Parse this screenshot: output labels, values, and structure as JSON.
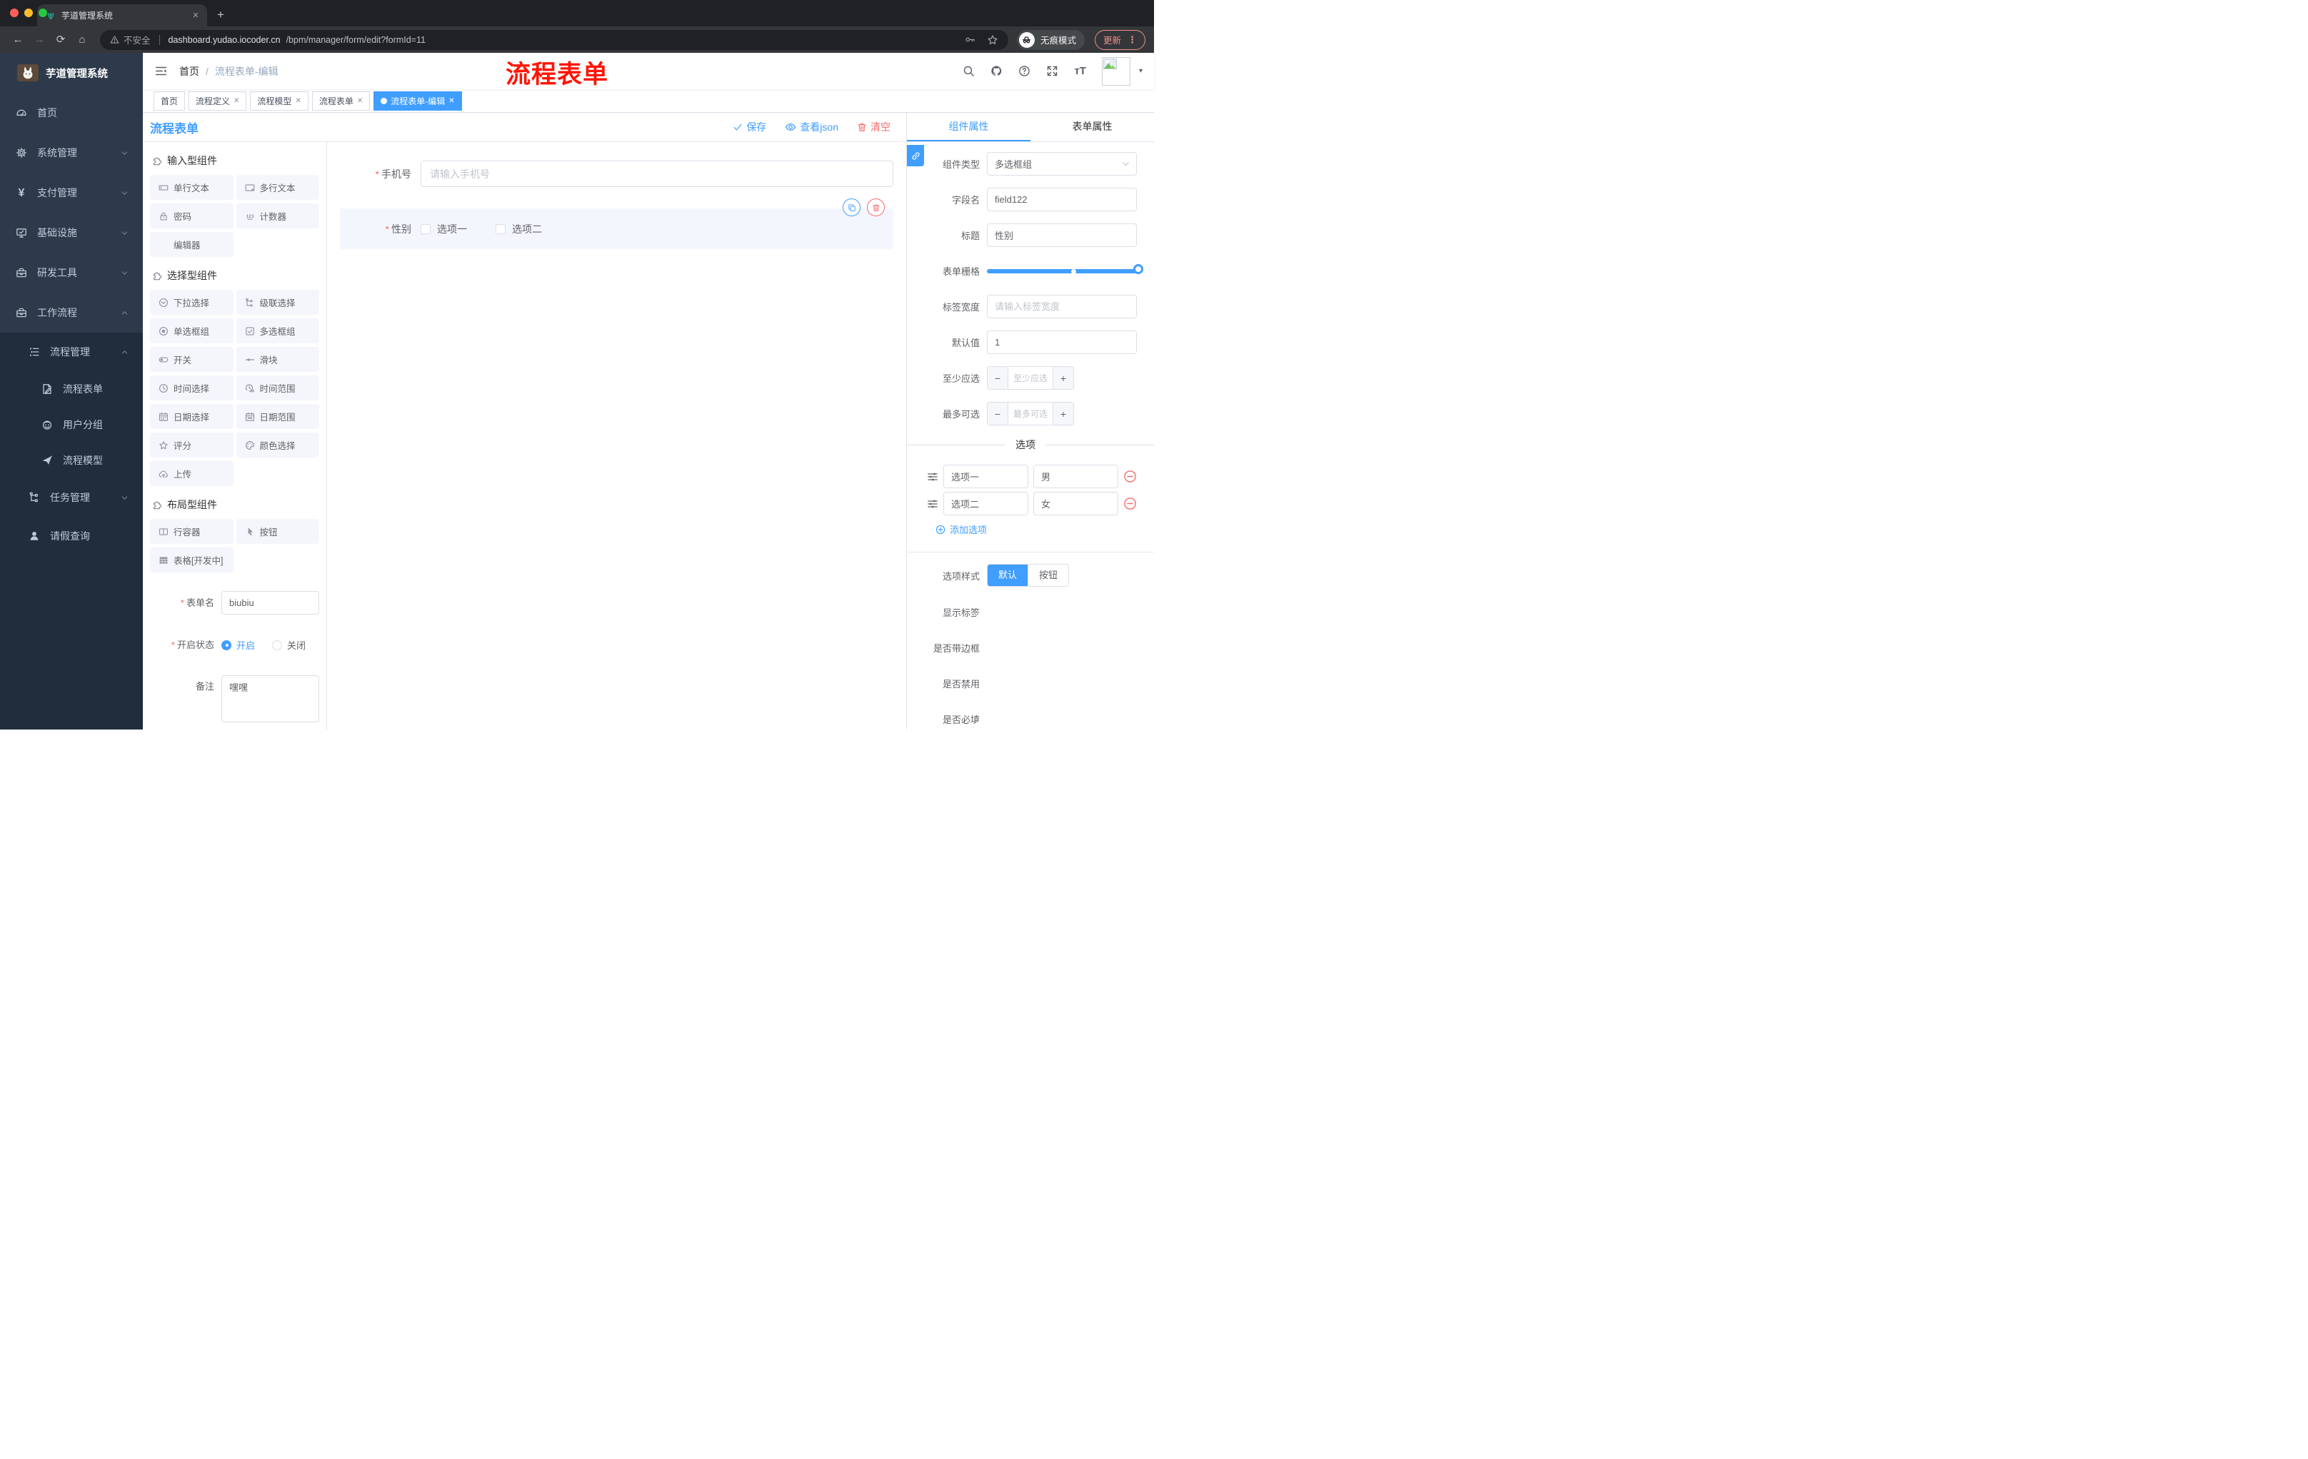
{
  "browser": {
    "tab_title": "芋道管理系统",
    "new_tab_glyph": "+",
    "close_glyph": "✕",
    "nav": {
      "back": "←",
      "forward": "→",
      "reload": "⟳",
      "home": "⌂"
    },
    "security_label": "不安全",
    "url_domain": "dashboard.yudao.iocoder.cn",
    "url_path": "/bpm/manager/form/edit?formId=11",
    "incognito_label": "无痕模式",
    "update_label": "更新",
    "menu_dots": "⋮",
    "avatar_caret": "▾"
  },
  "annotation": {
    "text": "流程表单",
    "color": "#fe1505"
  },
  "sidebar": {
    "logo_title": "芋道管理系统",
    "menu": [
      {
        "label": "首页",
        "icon": "dashboard-icon"
      },
      {
        "label": "系统管理",
        "icon": "gear-icon"
      },
      {
        "label": "支付管理",
        "icon": "yen-icon"
      },
      {
        "label": "基础设施",
        "icon": "monitor-icon"
      },
      {
        "label": "研发工具",
        "icon": "toolbox-icon"
      },
      {
        "label": "工作流程",
        "icon": "toolbox-icon"
      },
      {
        "label": "流程管理",
        "icon": "list-tree-icon"
      },
      {
        "label": "流程表单",
        "icon": "form-edit-icon"
      },
      {
        "label": "用户分组",
        "icon": "robot-icon"
      },
      {
        "label": "流程模型",
        "icon": "paper-plane-icon"
      },
      {
        "label": "任务管理",
        "icon": "tree-icon"
      },
      {
        "label": "请假查询",
        "icon": "user-icon"
      }
    ]
  },
  "header": {
    "breadcrumb_home": "首页",
    "breadcrumb_sep": "/",
    "breadcrumb_current": "流程表单-编辑"
  },
  "tags": [
    {
      "label": "首页"
    },
    {
      "label": "流程定义"
    },
    {
      "label": "流程模型"
    },
    {
      "label": "流程表单"
    },
    {
      "label": "流程表单-编辑"
    }
  ],
  "designer": {
    "panel_title": "流程表单",
    "save": "保存",
    "view_json": "查看json",
    "clear": "清空"
  },
  "palette": {
    "sections": [
      {
        "title": "输入型组件",
        "items": [
          {
            "label": "单行文本",
            "icon": "input-icon"
          },
          {
            "label": "多行文本",
            "icon": "textarea-icon"
          },
          {
            "label": "密码",
            "icon": "lock-icon"
          },
          {
            "label": "计数器",
            "icon": "counter-123-icon"
          },
          {
            "label": "编辑器",
            "icon": "none"
          }
        ]
      },
      {
        "title": "选择型组件",
        "items": [
          {
            "label": "下拉选择",
            "icon": "dropdown-icon"
          },
          {
            "label": "级联选择",
            "icon": "cascade-icon"
          },
          {
            "label": "单选框组",
            "icon": "radio-icon"
          },
          {
            "label": "多选框组",
            "icon": "checkbox-icon"
          },
          {
            "label": "开关",
            "icon": "switch-icon"
          },
          {
            "label": "滑块",
            "icon": "slider-icon"
          },
          {
            "label": "时间选择",
            "icon": "clock-icon"
          },
          {
            "label": "时间范围",
            "icon": "clock-range-icon"
          },
          {
            "label": "日期选择",
            "icon": "calendar-icon"
          },
          {
            "label": "日期范围",
            "icon": "calendar-range-icon"
          },
          {
            "label": "评分",
            "icon": "star-icon"
          },
          {
            "label": "颜色选择",
            "icon": "palette-icon"
          },
          {
            "label": "上传",
            "icon": "upload-icon"
          }
        ]
      },
      {
        "title": "布局型组件",
        "items": [
          {
            "label": "行容器",
            "icon": "columns-icon"
          },
          {
            "label": "按钮",
            "icon": "pointer-icon"
          },
          {
            "label": "表格[开发中]",
            "icon": "grid-icon"
          }
        ]
      }
    ]
  },
  "form_meta": {
    "name_label": "表单名",
    "name_value": "biubiu",
    "status_label": "开启状态",
    "status_on": "开启",
    "status_off": "关闭",
    "remark_label": "备注",
    "remark_value": "嘿嘿"
  },
  "canvas": {
    "phone": {
      "label": "手机号",
      "placeholder": "请输入手机号"
    },
    "gender": {
      "label": "性别",
      "option1": "选项一",
      "option2": "选项二"
    }
  },
  "inspector": {
    "tab_component": "组件属性",
    "tab_form": "表单属性",
    "component_type_label": "组件类型",
    "component_type_value": "多选框组",
    "field_name_label": "字段名",
    "field_name_value": "field122",
    "title_label": "标题",
    "title_value": "性别",
    "grid_label": "表单栅格",
    "label_width_label": "标签宽度",
    "label_width_placeholder": "请输入标签宽度",
    "default_label": "默认值",
    "default_value": "1",
    "min_label": "至少应选",
    "min_placeholder": "至少应选",
    "max_label": "最多可选",
    "max_placeholder": "最多可选",
    "minus_glyph": "−",
    "plus_glyph": "+",
    "options_title": "选项",
    "options": [
      {
        "label": "选项一",
        "value": "男"
      },
      {
        "label": "选项二",
        "value": "女"
      }
    ],
    "add_option": "添加选项",
    "style_label": "选项样式",
    "style_default": "默认",
    "style_button": "按钮",
    "toggle_show_label": "显示标签",
    "toggle_border": "是否带边框",
    "toggle_disabled": "是否禁用",
    "toggle_required": "是否必填"
  },
  "colors": {
    "accent": "#409eff",
    "danger": "#f56c6c",
    "sidebar_bg": "#2d3a4b",
    "submenu_bg": "#1f2d3d",
    "tag_active": "#409eff"
  }
}
